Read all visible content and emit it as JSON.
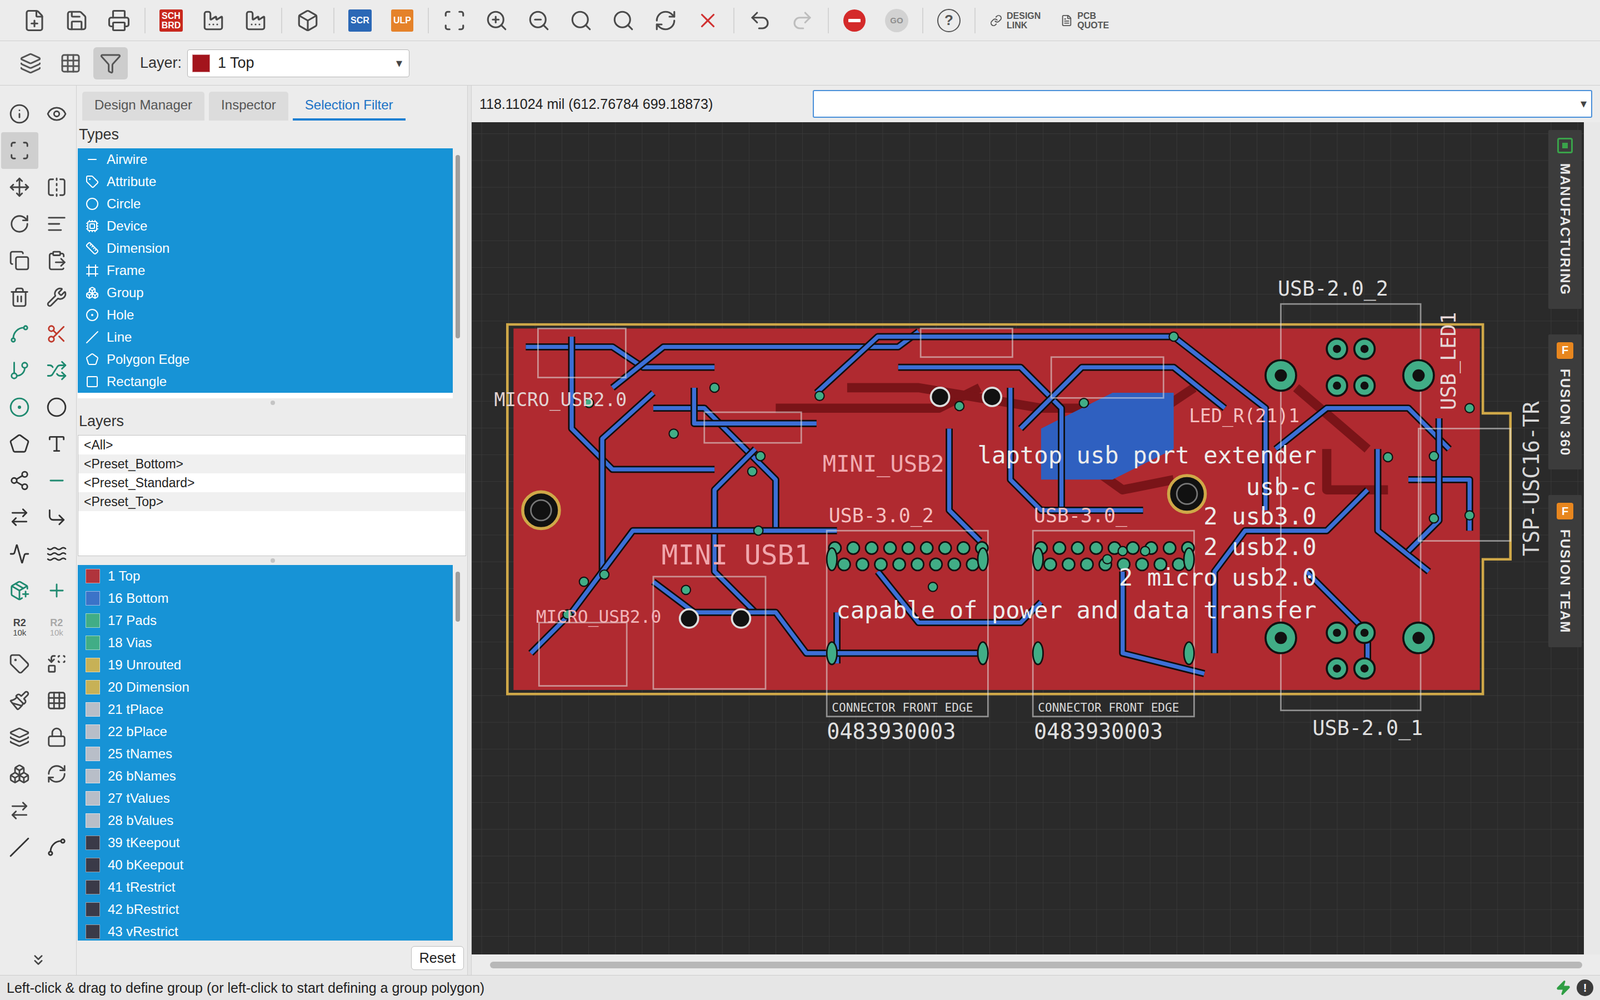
{
  "toolbar": {
    "items": [
      {
        "kind": "icon",
        "disabled": false
      },
      {
        "kind": "icon",
        "disabled": false
      },
      {
        "kind": "icon",
        "disabled": false
      },
      {
        "kind": "separator"
      },
      {
        "kind": "badge",
        "lines": [
          "SCH",
          "BRD"
        ],
        "color": "#c8281e"
      },
      {
        "kind": "icon",
        "disabled": false
      },
      {
        "kind": "icon",
        "disabled": false
      },
      {
        "kind": "separator"
      },
      {
        "kind": "icon",
        "disabled": false
      },
      {
        "kind": "separator"
      },
      {
        "kind": "badge",
        "lines": [
          "SCR"
        ],
        "color": "#2b68b6"
      },
      {
        "kind": "badge",
        "lines": [
          "ULP"
        ],
        "color": "#e5822a"
      },
      {
        "kind": "separator"
      },
      {
        "kind": "icon",
        "disabled": false
      },
      {
        "kind": "icon",
        "disabled": false
      },
      {
        "kind": "icon",
        "disabled": false
      },
      {
        "kind": "icon",
        "disabled": false
      },
      {
        "kind": "icon",
        "disabled": false
      },
      {
        "kind": "icon",
        "disabled": false
      },
      {
        "kind": "icon",
        "disabled": false
      },
      {
        "kind": "separator"
      },
      {
        "kind": "icon",
        "disabled": false
      },
      {
        "kind": "icon",
        "disabled": true
      },
      {
        "kind": "separator"
      },
      {
        "kind": "icon",
        "disabled": false
      },
      {
        "kind": "circle",
        "label": "GO",
        "disabled": true
      },
      {
        "kind": "separator"
      },
      {
        "kind": "circle",
        "label": "?",
        "disabled": false
      },
      {
        "kind": "separator"
      },
      {
        "kind": "link",
        "lines": [
          "DESIGN",
          "LINK"
        ]
      },
      {
        "kind": "link",
        "lines": [
          "PCB",
          "QUOTE"
        ]
      }
    ]
  },
  "layer_bar": {
    "tools": [
      {
        "selected": false
      },
      {
        "selected": false
      },
      {
        "selected": true
      }
    ],
    "label": "Layer:",
    "value": "1 Top",
    "color": "#a3141c",
    "arrow": "▾"
  },
  "palette": [
    {
      "kind": "tool",
      "selected": false
    },
    {
      "kind": "tool",
      "selected": false
    },
    {
      "kind": "tool",
      "selected": true
    },
    {
      "kind": "empty"
    },
    {
      "kind": "tool",
      "selected": false
    },
    {
      "kind": "tool",
      "selected": false
    },
    {
      "kind": "tool",
      "selected": false
    },
    {
      "kind": "tool",
      "selected": false
    },
    {
      "kind": "tool",
      "selected": false
    },
    {
      "kind": "tool",
      "selected": false
    },
    {
      "kind": "tool",
      "selected": false
    },
    {
      "kind": "tool",
      "selected": false
    },
    {
      "kind": "tool",
      "selected": false
    },
    {
      "kind": "tool",
      "selected": false
    },
    {
      "kind": "tool",
      "selected": false
    },
    {
      "kind": "tool",
      "selected": false
    },
    {
      "kind": "tool",
      "selected": false
    },
    {
      "kind": "tool",
      "selected": false
    },
    {
      "kind": "tool",
      "selected": false
    },
    {
      "kind": "tool",
      "selected": false
    },
    {
      "kind": "tool",
      "selected": false
    },
    {
      "kind": "tool",
      "selected": false
    },
    {
      "kind": "tool",
      "selected": false
    },
    {
      "kind": "tool",
      "selected": false
    },
    {
      "kind": "tool",
      "selected": false
    },
    {
      "kind": "tool",
      "selected": false
    },
    {
      "kind": "tool",
      "selected": false
    },
    {
      "kind": "tool",
      "selected": false
    },
    {
      "kind": "value",
      "label": "R2",
      "value": "10k",
      "disabled": false
    },
    {
      "kind": "value",
      "label": "R2",
      "value": "10k",
      "disabled": true
    },
    {
      "kind": "tool",
      "selected": false
    },
    {
      "kind": "tool",
      "selected": false
    },
    {
      "kind": "tool",
      "selected": false
    },
    {
      "kind": "tool",
      "selected": false
    },
    {
      "kind": "tool",
      "selected": false
    },
    {
      "kind": "tool",
      "selected": false
    },
    {
      "kind": "tool",
      "selected": false
    },
    {
      "kind": "tool",
      "selected": false
    },
    {
      "kind": "tool",
      "selected": false
    },
    {
      "kind": "empty"
    },
    {
      "kind": "tool",
      "selected": false
    },
    {
      "kind": "tool",
      "selected": false
    },
    {
      "kind": "more",
      "selected": false
    }
  ],
  "panel": {
    "tabs": [
      {
        "label": "Design Manager",
        "selected": false
      },
      {
        "label": "Inspector",
        "selected": false
      },
      {
        "label": "Selection Filter",
        "selected": true
      }
    ],
    "types_title": "Types",
    "types": [
      {
        "label": "Airwire",
        "selected": true
      },
      {
        "label": "Attribute",
        "selected": true
      },
      {
        "label": "Circle",
        "selected": true
      },
      {
        "label": "Device",
        "selected": true
      },
      {
        "label": "Dimension",
        "selected": true
      },
      {
        "label": "Frame",
        "selected": true
      },
      {
        "label": "Group",
        "selected": true
      },
      {
        "label": "Hole",
        "selected": true
      },
      {
        "label": "Line",
        "selected": true
      },
      {
        "label": "Polygon Edge",
        "selected": true
      },
      {
        "label": "Rectangle",
        "selected": true
      }
    ],
    "layers_title": "Layers",
    "presets": [
      {
        "label": "<All>",
        "selected": false
      },
      {
        "label": "<Preset_Bottom>",
        "selected": false
      },
      {
        "label": "<Preset_Standard>",
        "selected": false
      },
      {
        "label": "<Preset_Top>",
        "selected": false
      }
    ],
    "layers": [
      {
        "label": "1 Top",
        "color": "#b0343c",
        "selected": true
      },
      {
        "label": "16 Bottom",
        "color": "#3b73c8",
        "selected": true
      },
      {
        "label": "17 Pads",
        "color": "#41ad86",
        "selected": true
      },
      {
        "label": "18 Vias",
        "color": "#41ad86",
        "selected": true
      },
      {
        "label": "19 Unrouted",
        "color": "#c7b156",
        "selected": true
      },
      {
        "label": "20 Dimension",
        "color": "#c7b156",
        "selected": true
      },
      {
        "label": "21 tPlace",
        "color": "#b8bec8",
        "selected": true
      },
      {
        "label": "22 bPlace",
        "color": "#b8bec8",
        "selected": true
      },
      {
        "label": "25 tNames",
        "color": "#b8bec8",
        "selected": true
      },
      {
        "label": "26 bNames",
        "color": "#b8bec8",
        "selected": true
      },
      {
        "label": "27 tValues",
        "color": "#b8bec8",
        "selected": true
      },
      {
        "label": "28 bValues",
        "color": "#b8bec8",
        "selected": true
      },
      {
        "label": "39 tKeepout",
        "color": "#3a3a48",
        "selected": true
      },
      {
        "label": "40 bKeepout",
        "color": "#3a3a48",
        "selected": true
      },
      {
        "label": "41 tRestrict",
        "color": "#3a3a48",
        "selected": true
      },
      {
        "label": "42 bRestrict",
        "color": "#3a3a48",
        "selected": true
      },
      {
        "label": "43 vRestrict",
        "color": "#3a3a48",
        "selected": true
      }
    ],
    "reset": "Reset"
  },
  "coordinates": "118.11024 mil (612.76784 699.18873)",
  "command": {
    "arrow": "▾"
  },
  "board": {
    "labels": [
      "USB-2.0_2",
      "USB_LED1",
      "MICRO_USB2.0",
      "MINI_USB2",
      "MINI USB1",
      "USB-3.0_2",
      "USB-3.0_",
      "LED_R(21)1",
      "MICRO_USB2.0",
      "CONNECTOR FRONT EDGE",
      "CONNECTOR FRONT EDGE",
      "0483930003",
      "0483930003",
      "USB-2.0_1",
      "TSP-USC16-TR"
    ],
    "notes": [
      "laptop usb port extender",
      "usb-c",
      "2 usb3.0",
      "2 usb2.0",
      "2 micro usb2.0",
      "capable of power and data transfer"
    ]
  },
  "side_tabs": [
    {
      "label": "MANUFACTURING",
      "kind": "chip",
      "color": "#3aa34a"
    },
    {
      "label": "FUSION 360",
      "kind": "letter",
      "badge": "F",
      "color": "#e8861e"
    },
    {
      "label": "FUSION TEAM",
      "kind": "letter",
      "badge": "F",
      "color": "#e8861e"
    }
  ],
  "status_bar": {
    "text": "Left-click & drag to define group (or left-click to start defining a group polygon)",
    "alert": "!"
  }
}
